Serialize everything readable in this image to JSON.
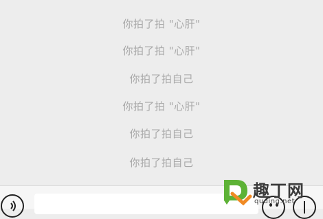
{
  "chat": {
    "notices": [
      "你拍了拍 \"心肝\"",
      "你拍了拍 \"心肝\"",
      "你拍了拍自己",
      "你拍了拍 \"心肝\"",
      "你拍了拍自己",
      "你拍了拍自己"
    ]
  },
  "input": {
    "value": ""
  },
  "watermark": {
    "text": "趣丁网",
    "sub": "quding.net",
    "color_green": "#5db236",
    "color_orange": "#f08a24"
  },
  "icons": {
    "voice": "voice-icon",
    "emoji": "emoji-icon",
    "plus": "plus-icon"
  }
}
